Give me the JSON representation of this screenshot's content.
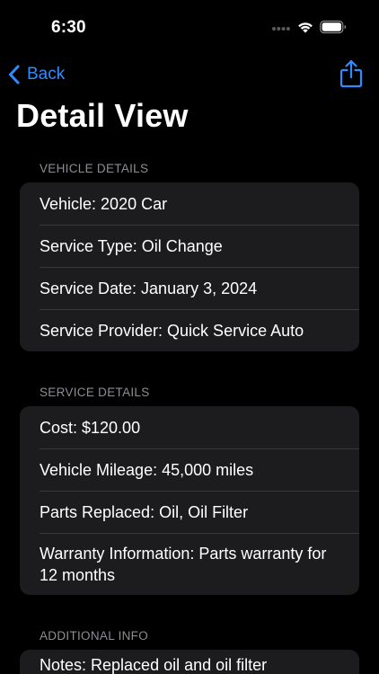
{
  "status_bar": {
    "time": "6:30"
  },
  "nav": {
    "back_label": "Back",
    "title": "Detail View",
    "share_icon": "share-icon"
  },
  "sections": {
    "vehicle": {
      "header": "VEHICLE DETAILS",
      "rows": [
        "Vehicle: 2020 Car",
        "Service Type: Oil Change",
        "Service Date: January 3, 2024",
        "Service Provider: Quick Service Auto"
      ]
    },
    "service": {
      "header": "SERVICE DETAILS",
      "rows": [
        "Cost: $120.00",
        "Vehicle Mileage: 45,000 miles",
        "Parts Replaced: Oil, Oil Filter",
        "Warranty Information: Parts warranty for 12 months"
      ]
    },
    "additional": {
      "header": "ADDITIONAL INFO",
      "rows": [
        "Notes: Replaced oil and oil filter"
      ]
    }
  },
  "colors": {
    "background": "#000000",
    "card": "#1c1c1e",
    "separator": "#38383a",
    "accent": "#2f8cff",
    "secondary_text": "#8d8d93"
  }
}
